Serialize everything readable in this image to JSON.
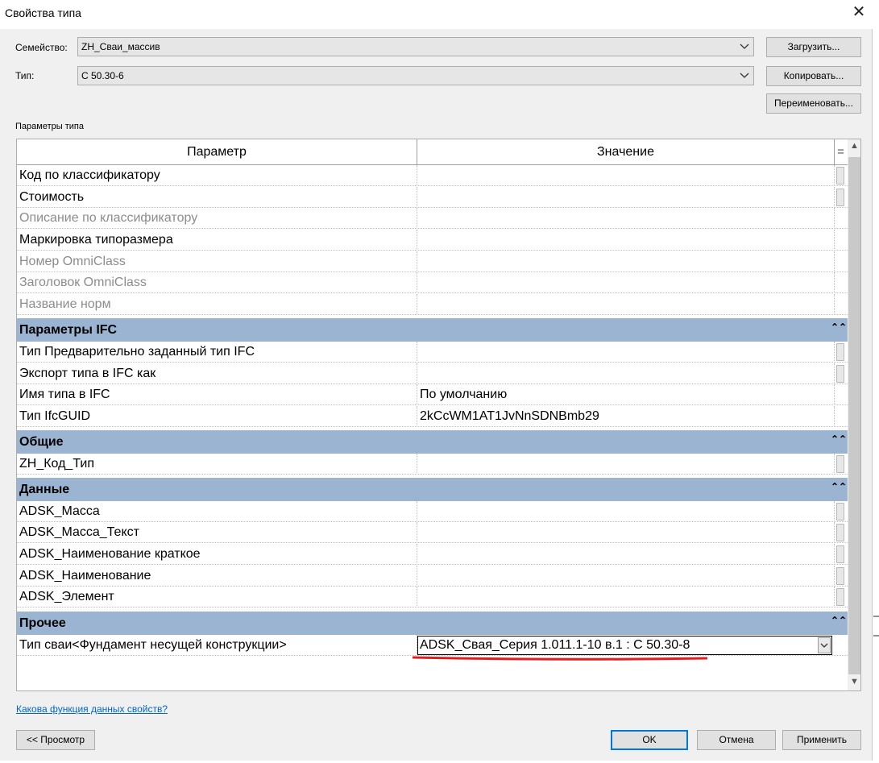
{
  "window": {
    "title": "Свойства типа",
    "close_glyph": "✕"
  },
  "family": {
    "label": "Семейство:",
    "value": "ZH_Сваи_массив"
  },
  "type": {
    "label": "Тип:",
    "value": "С 50.30-6"
  },
  "buttons": {
    "load": "Загрузить...",
    "copy": "Копировать...",
    "rename": "Переименовать...",
    "preview": "<< Просмотр",
    "ok": "OK",
    "cancel": "Отмена",
    "apply": "Применить"
  },
  "section_label": "Параметры типа",
  "grid": {
    "col_param": "Параметр",
    "col_value": "Значение",
    "col_menu": "=",
    "rows_top": [
      {
        "param": "Код по классификатору",
        "value": ""
      },
      {
        "param": "Стоимость",
        "value": ""
      },
      {
        "param": "Описание по классификатору",
        "value": ""
      },
      {
        "param": "Маркировка типоразмера",
        "value": ""
      },
      {
        "param": "Номер OmniClass",
        "value": ""
      },
      {
        "param": "Заголовок OmniClass",
        "value": ""
      },
      {
        "param": "Название норм",
        "value": ""
      }
    ],
    "groups": {
      "ifc": {
        "title": "Параметры IFC",
        "rows": [
          {
            "param": "Тип Предварительно заданный тип IFC",
            "value": ""
          },
          {
            "param": "Экспорт типа в IFC как",
            "value": ""
          },
          {
            "param": "Имя типа в IFC",
            "value": "По умолчанию"
          },
          {
            "param": "Тип IfcGUID",
            "value": "2kCcWM1AT1JvNnSDNBmb29"
          }
        ]
      },
      "general": {
        "title": "Общие",
        "rows": [
          {
            "param": "ZH_Код_Тип",
            "value": ""
          }
        ]
      },
      "data": {
        "title": "Данные",
        "rows": [
          {
            "param": "ADSK_Масса",
            "value": ""
          },
          {
            "param": "ADSK_Масса_Текст",
            "value": ""
          },
          {
            "param": "ADSK_Наименование краткое",
            "value": ""
          },
          {
            "param": "ADSK_Наименование",
            "value": ""
          },
          {
            "param": "ADSK_Элемент",
            "value": ""
          }
        ]
      },
      "other": {
        "title": "Прочее",
        "rows": [
          {
            "param": "Тип сваи<Фундамент несущей конструкции>",
            "value": "ADSK_Свая_Серия 1.011.1-10 в.1 : С 50.30-8"
          }
        ]
      }
    },
    "collapse_glyph": "⌃⌃",
    "scroll_up": "▲",
    "scroll_down": "▼"
  },
  "help_link": "Какова функция данных свойств?",
  "colors": {
    "group_header": "#9bb4d1",
    "highlight_underline": "#e02020",
    "primary_border": "#0078d7",
    "link": "#0066cc"
  },
  "icons": [
    "close-icon",
    "chevron-down-icon",
    "collapse-icon",
    "scroll-up-icon",
    "scroll-down-icon"
  ]
}
